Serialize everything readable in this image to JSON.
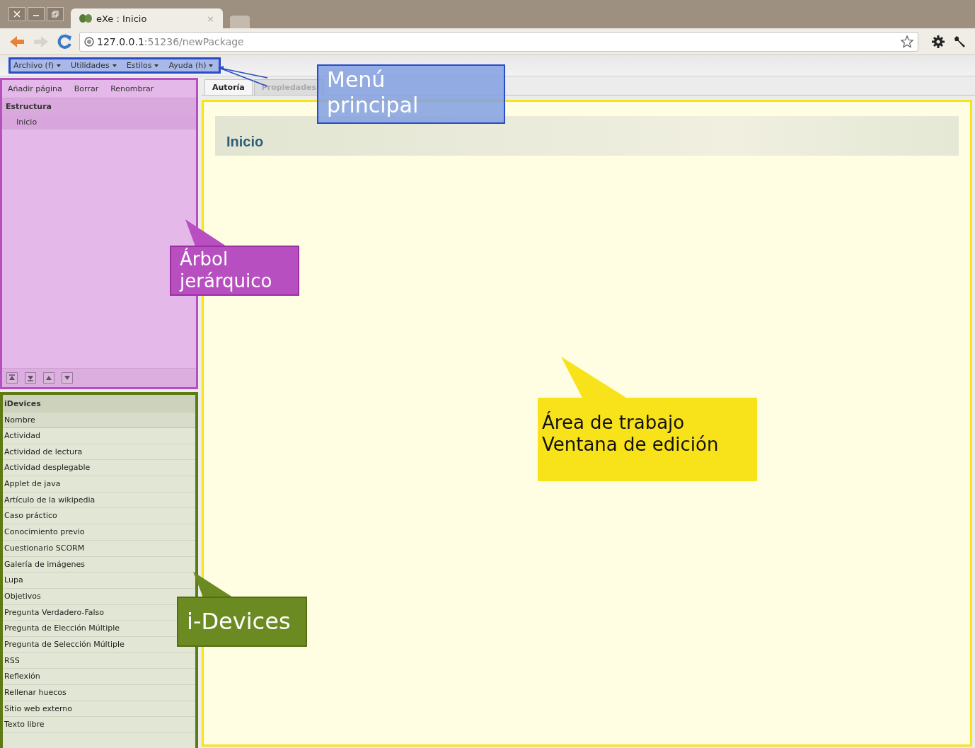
{
  "browser": {
    "tab_title": "eXe : Inicio",
    "tab_close": "×",
    "url_host": "127.0.0.1",
    "url_rest": ":51236/newPackage"
  },
  "menu": [
    {
      "label": "Archivo (f)"
    },
    {
      "label": "Utilidades"
    },
    {
      "label": "Estilos"
    },
    {
      "label": "Ayuda (h)"
    }
  ],
  "tree_toolbar": [
    "Añadir página",
    "Borrar",
    "Renombrar"
  ],
  "tree": {
    "heading": "Estructura",
    "items": [
      {
        "label": "Inicio",
        "selected": true
      }
    ]
  },
  "idevices": {
    "heading": "iDevices",
    "column": "Nombre",
    "items": [
      "Actividad",
      "Actividad de lectura",
      "Actividad desplegable",
      "Applet de java",
      "Artículo de la wikipedia",
      "Caso práctico",
      "Conocimiento previo",
      "Cuestionario SCORM",
      "Galería de imágenes",
      "Lupa",
      "Objetivos",
      "Pregunta Verdadero-Falso",
      "Pregunta de Elección Múltiple",
      "Pregunta de Selección Múltiple",
      "RSS",
      "Reflexión",
      "Rellenar huecos",
      "Sitio web externo",
      "Texto libre"
    ]
  },
  "tabs": [
    {
      "label": "Autoría",
      "selected": true
    },
    {
      "label": "Propiedades",
      "selected": false
    }
  ],
  "page_title": "Inicio",
  "callouts": [
    {
      "kind": "menu",
      "lines": [
        "Menú",
        "principal"
      ]
    },
    {
      "kind": "tree",
      "lines": [
        "Árbol",
        "jerárquico"
      ]
    },
    {
      "kind": "work",
      "lines": [
        "Área de trabajo",
        "Ventana de edición"
      ]
    },
    {
      "kind": "idevices",
      "lines": [
        "i-Devices"
      ]
    }
  ]
}
